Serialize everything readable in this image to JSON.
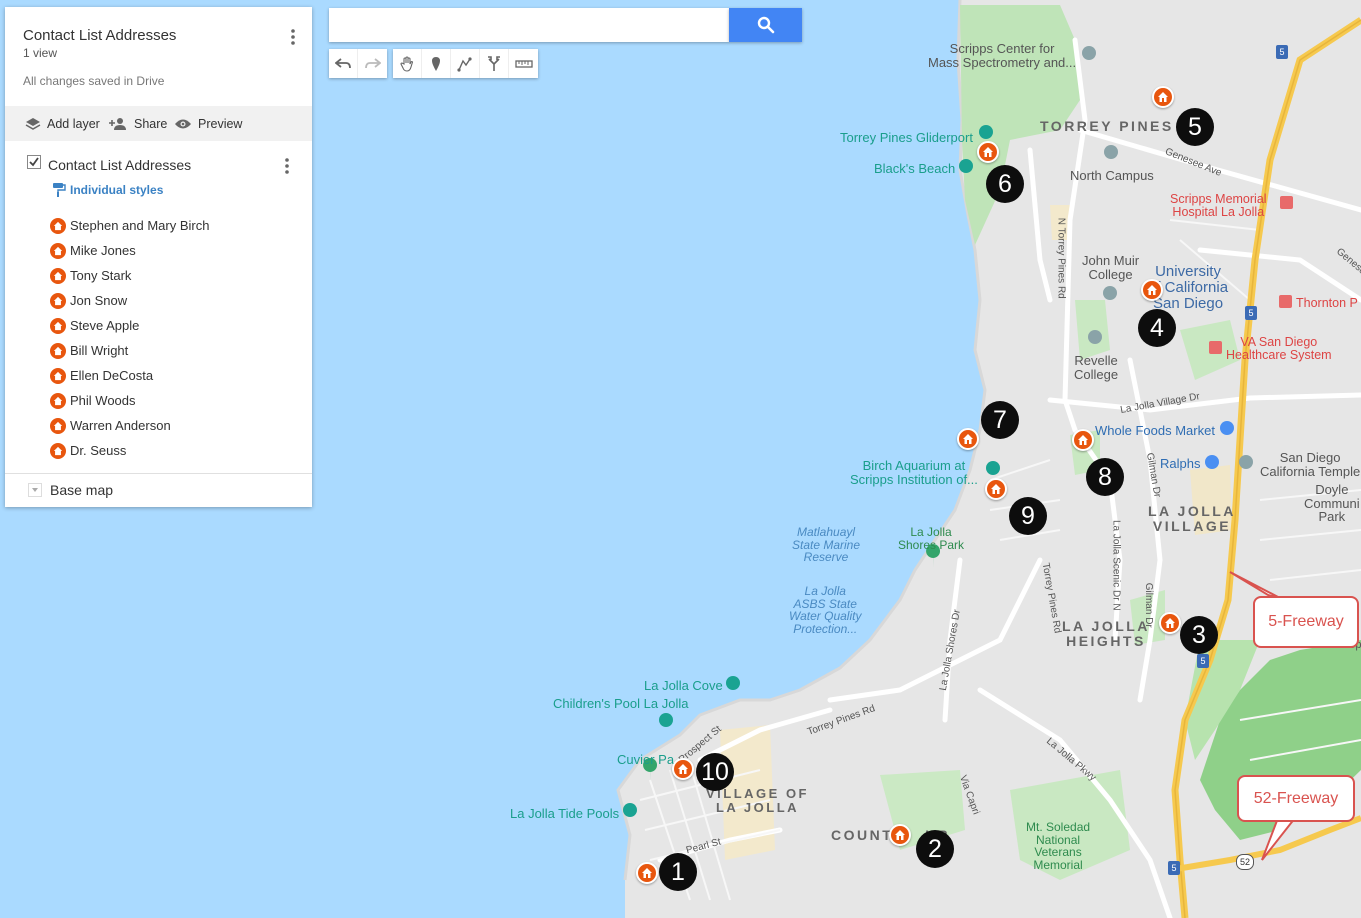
{
  "panel": {
    "title": "Contact List Addresses",
    "views": "1 view",
    "saved": "All changes saved in Drive",
    "add_layer": "Add layer",
    "share": "Share",
    "preview": "Preview",
    "layer_title": "Contact List Addresses",
    "layer_checked": true,
    "styles": "Individual styles",
    "items": [
      {
        "label": "Stephen and Mary Birch"
      },
      {
        "label": "Mike Jones"
      },
      {
        "label": "Tony Stark"
      },
      {
        "label": "Jon Snow"
      },
      {
        "label": "Steve Apple"
      },
      {
        "label": "Bill Wright"
      },
      {
        "label": "Ellen DeCosta"
      },
      {
        "label": "Phil Woods"
      },
      {
        "label": "Warren Anderson"
      },
      {
        "label": "Dr. Seuss"
      }
    ],
    "base_map": "Base map"
  },
  "search": {
    "value": "",
    "placeholder": ""
  },
  "toolbar": {
    "icons": [
      "undo-icon",
      "redo-icon",
      "hand-icon",
      "marker-icon",
      "draw-line-icon",
      "directions-icon",
      "ruler-icon"
    ]
  },
  "markers": {
    "m1": "1",
    "m2": "2",
    "m3": "3",
    "m4": "4",
    "m5": "5",
    "m6": "6",
    "m7": "7",
    "m8": "8",
    "m9": "9",
    "m10": "10"
  },
  "callouts": {
    "five": "5-Freeway",
    "fiftytwo": "52-Freeway"
  },
  "labels": {
    "scripps_center": "Scripps Center for\nMass Spectrometry and...",
    "torrey_pines": "TORREY PINES",
    "gliderport": "Torrey Pines Gliderport",
    "blacks_beach": "Black's Beach",
    "north_campus": "North Campus",
    "genesee": "Genesee Ave",
    "scripps_memorial": "Scripps Memorial\nHospital La Jolla",
    "n_torrey_pines_rd": "N Torrey Pines Rd",
    "john_muir": "John Muir\nCollege",
    "ucsd": "University\nof California\nSan Diego",
    "thornton": "Thornton P",
    "va": "VA San Diego\nHealthcare System",
    "revelle": "Revelle\nCollege",
    "la_jolla_village_dr": "La Jolla Village Dr",
    "whole_foods": "Whole Foods Market",
    "ralphs": "Ralphs",
    "sd_temple": "San Diego\nCalifornia Temple",
    "doyle": "Doyle\nCommuni\nPark",
    "birch": "Birch Aquarium at\nScripps Institution of...",
    "gilman": "Gilman Dr",
    "la_jolla_village": "LA JOLLA\nVILLAGE",
    "matlahuayl": "Matlahuayl\nState Marine\nReserve",
    "la_jolla_shores_park": "La Jolla\nShores Park",
    "asbs": "La Jolla\nASBS State\nWater Quality\nProtection...",
    "torrey_pines_rd": "Torrey Pines Rd",
    "la_jolla_scenic": "La Jolla Scenic Dr N",
    "gilman2": "Gilman Dr",
    "la_jolla_heights": "LA JOLLA\nHEIGHTS",
    "la_jolla_shores_dr": "La Jolla Shores Dr",
    "la_jolla_cove": "La Jolla Cove",
    "childrens_pool": "Children's Pool La Jolla",
    "torrey_pines_rd2": "Torrey Pines Rd",
    "cuvier": "Cuvier Pa",
    "prospect": "Prospect St",
    "village_la_jolla": "VILLAGE OF\nLA JOLLA",
    "la_jolla_pkwy": "La Jolla Pkwy",
    "tide_pools": "La Jolla Tide Pools",
    "via_capri": "Via Capri",
    "country_club": "COUNT     UB",
    "mt_soledad": "Mt. Soledad\nNational\nVeterans\nMemorial",
    "pearl": "Pearl St",
    "genesee2": "Genese",
    "i5a": "5",
    "i5b": "5",
    "i5c": "5",
    "i5d": "5",
    "r52": "52",
    "sp": "Sp"
  },
  "colors": {
    "water": "#aadaff",
    "land": "#e8e8e8",
    "park": "#c4e8bf",
    "highway": "#f6c94e",
    "marker_home": "#e8560e",
    "number_marker": "#0d0d0d",
    "callout": "#d9534f",
    "search_button": "#4285f4"
  }
}
